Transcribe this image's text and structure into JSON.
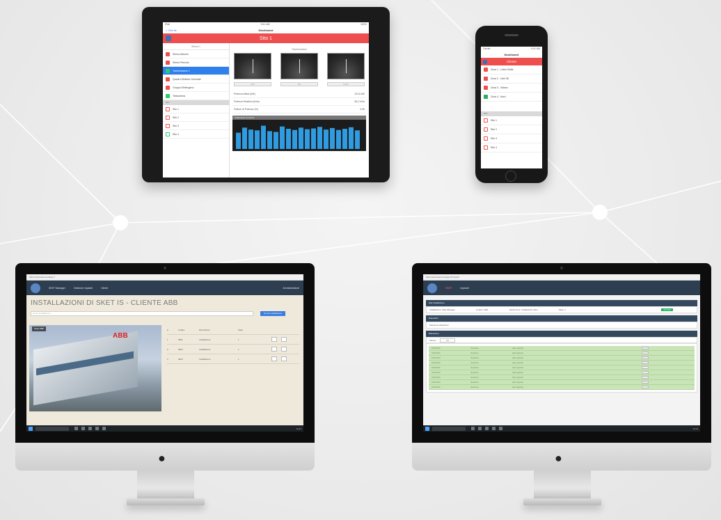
{
  "colors": {
    "accent_red": "#ef4e4e",
    "nav_dark": "#2c3e50",
    "ios_blue": "#2f80ed",
    "row_green": "#c9e5b8"
  },
  "ipad": {
    "carrier": "iPad",
    "time": "9:41 AM",
    "battery": "100%",
    "back_label": "< Cliente",
    "nav_title": "Dashboard",
    "header_title": "Sito 1",
    "segments": [
      "Sirena 1",
      "Trasformatore"
    ],
    "list_items": [
      {
        "label": "Sirena Allarme",
        "icon": "alarm-icon"
      },
      {
        "label": "Sirena Pericolo",
        "icon": "alarm-icon"
      },
      {
        "label": "Trasformatore 1",
        "icon": "transformer-icon"
      },
      {
        "label": "Quadro Elettrico Generale",
        "icon": "panel-icon"
      },
      {
        "label": "Gruppo Elettrogeno",
        "icon": "generator-icon"
      },
      {
        "label": "Telecamera",
        "icon": "camera-icon"
      }
    ],
    "section_label": "SITI",
    "site_items": [
      {
        "label": "Sito 1",
        "icon": "site-icon"
      },
      {
        "label": "Sito 2",
        "icon": "site-icon"
      },
      {
        "label": "Sito 3",
        "icon": "site-icon"
      },
      {
        "label": "Sito 4",
        "icon": "site-icon"
      }
    ],
    "gauges": [
      {
        "label": "kV/h"
      },
      {
        "label": "kW"
      },
      {
        "label": "kVAR"
      }
    ],
    "metrics": [
      {
        "label": "Potenza Attiva (kW)",
        "value": "124,5 kW"
      },
      {
        "label": "Potenza Reattiva (kVar)",
        "value": "36,2 kVar"
      },
      {
        "label": "Fattore di Potenza (%)",
        "value": "0,96"
      }
    ],
    "chart_header": "Andamento Consumi",
    "chart_values": [
      42,
      55,
      50,
      48,
      60,
      46,
      44,
      58,
      52,
      49,
      55,
      51,
      53,
      57,
      50,
      54,
      49,
      52,
      56,
      48
    ]
  },
  "iphone": {
    "carrier": "Carrier",
    "time": "9:41 AM",
    "nav_title": "Dashboard",
    "header_title": "Cliente",
    "list_items": [
      {
        "label": "Zona 1 - Linea Gialla",
        "icon": "zone-icon",
        "color": "#ef4e4e"
      },
      {
        "label": "Zona 2 - Vani 3D",
        "icon": "zone-icon",
        "color": "#ef4e4e"
      },
      {
        "label": "Zona 3 - Vaiano",
        "icon": "zone-icon",
        "color": "#ef4e4e"
      },
      {
        "label": "Zona 4 - Nord",
        "icon": "zone-icon",
        "color": "#27ae60"
      }
    ],
    "section_label": "SITI",
    "site_items": [
      {
        "label": "Sito 1"
      },
      {
        "label": "Sito 2"
      },
      {
        "label": "Sito 3"
      },
      {
        "label": "Sito 4"
      }
    ]
  },
  "imac_left": {
    "url": "https://www.sket-manager.it",
    "app_name": "SKET Manager",
    "menu": [
      "Gestione Impianti",
      "Clienti"
    ],
    "user": "Amministratore",
    "page_title": "INSTALLAZIONI DI SKET IS - CLIENTE ABB",
    "search_placeholder": "Cerca installazione...",
    "add_button": "Nuova installazione",
    "photo_tag": "Sede ABB",
    "table_headers": [
      "#",
      "Codice",
      "Descrizione",
      "Stato"
    ],
    "rows": [
      {
        "id": "1",
        "code": "0001",
        "desc": "Installazione",
        "status": "1"
      },
      {
        "id": "2",
        "code": "0002",
        "desc": "Installazione",
        "status": "1"
      },
      {
        "id": "3",
        "code": "0003",
        "desc": "Installazione",
        "status": "1"
      }
    ],
    "taskbar_clock": "10:24"
  },
  "imac_right": {
    "url": "https://www.sket-manager.it/impianti",
    "app_name": "SKET",
    "menu": [
      "Impianti"
    ],
    "panel1_header": "Dati installazione",
    "panel1_fields": [
      "Installazione: Sket Manager",
      "Codice: 0001",
      "Descrizione: Installazione Sket",
      "Stato: 1"
    ],
    "panel1_badge": "ATTIVO",
    "panel2_header": "Dispositivi",
    "panel2_placeholder": "Seleziona dispositivo",
    "panel3_header": "Rilevazioni",
    "filter_label": "Mostra",
    "filter_value": "10",
    "rows": [
      {
        "c1": "01/01/2019",
        "c2": "rilevazione",
        "c3": "dato registrato"
      },
      {
        "c1": "01/01/2019",
        "c2": "rilevazione",
        "c3": "dato registrato"
      },
      {
        "c1": "01/01/2019",
        "c2": "rilevazione",
        "c3": "dato registrato"
      },
      {
        "c1": "01/01/2019",
        "c2": "rilevazione",
        "c3": "dato registrato"
      },
      {
        "c1": "01/01/2019",
        "c2": "rilevazione",
        "c3": "dato registrato"
      },
      {
        "c1": "01/01/2019",
        "c2": "rilevazione",
        "c3": "dato registrato"
      },
      {
        "c1": "01/01/2019",
        "c2": "rilevazione",
        "c3": "dato registrato"
      },
      {
        "c1": "01/01/2019",
        "c2": "rilevazione",
        "c3": "dato registrato"
      },
      {
        "c1": "01/01/2019",
        "c2": "rilevazione",
        "c3": "dato registrato"
      }
    ],
    "taskbar_clock": "10:24"
  }
}
